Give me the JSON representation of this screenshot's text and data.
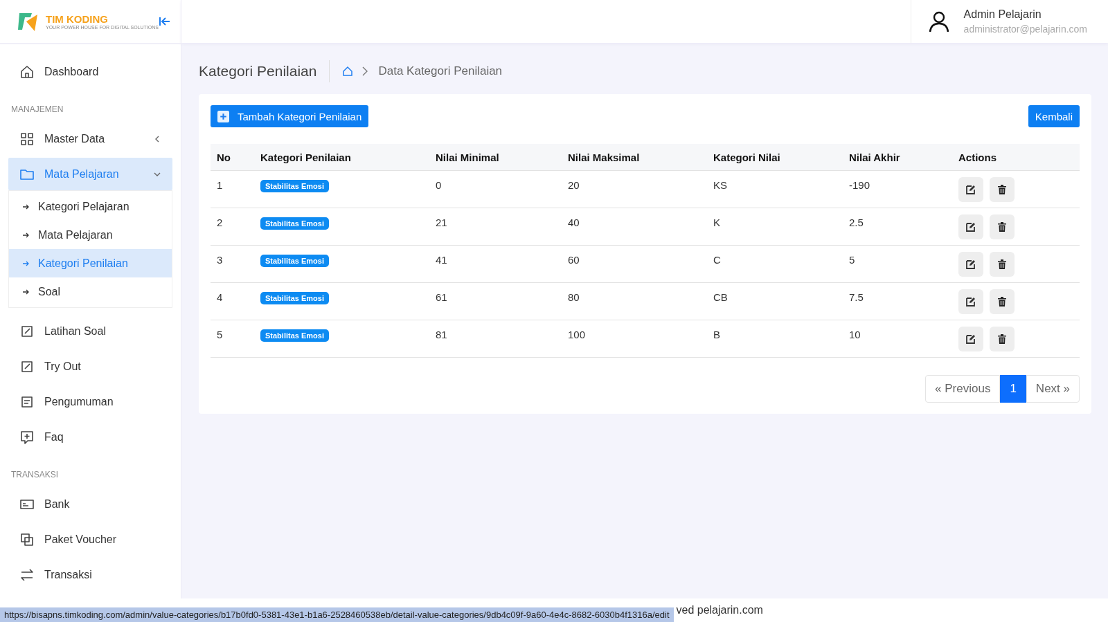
{
  "logo": {
    "name": "TIM KODING",
    "tagline": "YOUR POWER HOUSE FOR DIGITAL SOLUTIONS"
  },
  "user": {
    "name": "Admin Pelajarin",
    "email": "administrator@pelajarin.com"
  },
  "sidebar": {
    "items": [
      {
        "kind": "item",
        "label": "Dashboard",
        "selected": false
      },
      {
        "kind": "section",
        "label": "MANAJEMEN"
      },
      {
        "kind": "item",
        "label": "Master Data",
        "selected": false,
        "expanded": false
      },
      {
        "kind": "item",
        "label": "Mata Pelajaran",
        "selected": true,
        "expanded": true,
        "children": [
          {
            "label": "Kategori Pelajaran",
            "selected": false
          },
          {
            "label": "Mata Pelajaran",
            "selected": false
          },
          {
            "label": "Kategori Penilaian",
            "selected": true
          },
          {
            "label": "Soal",
            "selected": false
          }
        ]
      },
      {
        "kind": "item",
        "label": "Latihan Soal",
        "selected": false
      },
      {
        "kind": "item",
        "label": "Try Out",
        "selected": false
      },
      {
        "kind": "item",
        "label": "Pengumuman",
        "selected": false
      },
      {
        "kind": "item",
        "label": "Faq",
        "selected": false
      },
      {
        "kind": "section",
        "label": "TRANSAKSI"
      },
      {
        "kind": "item",
        "label": "Bank",
        "selected": false
      },
      {
        "kind": "item",
        "label": "Paket Voucher",
        "selected": false
      },
      {
        "kind": "item",
        "label": "Transaksi",
        "selected": false
      }
    ]
  },
  "page": {
    "title": "Kategori Penilaian",
    "breadcrumb": "Data Kategori Penilaian"
  },
  "buttons": {
    "add": "Tambah Kategori Penilaian",
    "back": "Kembali"
  },
  "table": {
    "columns": [
      "No",
      "Kategori Penilaian",
      "Nilai Minimal",
      "Nilai Maksimal",
      "Kategori Nilai",
      "Nilai Akhir",
      "Actions"
    ],
    "rows": [
      {
        "no": "1",
        "category": "Stabilitas Emosi",
        "min": "0",
        "max": "20",
        "grade": "KS",
        "final": "-190"
      },
      {
        "no": "2",
        "category": "Stabilitas Emosi",
        "min": "21",
        "max": "40",
        "grade": "K",
        "final": "2.5"
      },
      {
        "no": "3",
        "category": "Stabilitas Emosi",
        "min": "41",
        "max": "60",
        "grade": "C",
        "final": "5"
      },
      {
        "no": "4",
        "category": "Stabilitas Emosi",
        "min": "61",
        "max": "80",
        "grade": "CB",
        "final": "7.5"
      },
      {
        "no": "5",
        "category": "Stabilitas Emosi",
        "min": "81",
        "max": "100",
        "grade": "B",
        "final": "10"
      }
    ]
  },
  "pagination": [
    {
      "label": "« Previous",
      "selected": false
    },
    {
      "label": "1",
      "selected": true
    },
    {
      "label": "Next »",
      "selected": false
    }
  ],
  "footer": "ved pelajarin.com",
  "status_url": "https://bisapns.timkoding.com/admin/value-categories/b17b0fd0-5381-43e1-b1a6-2528460538eb/detail-value-categories/9db4c09f-9a60-4e4c-8682-6030b4f1316a/edit"
}
